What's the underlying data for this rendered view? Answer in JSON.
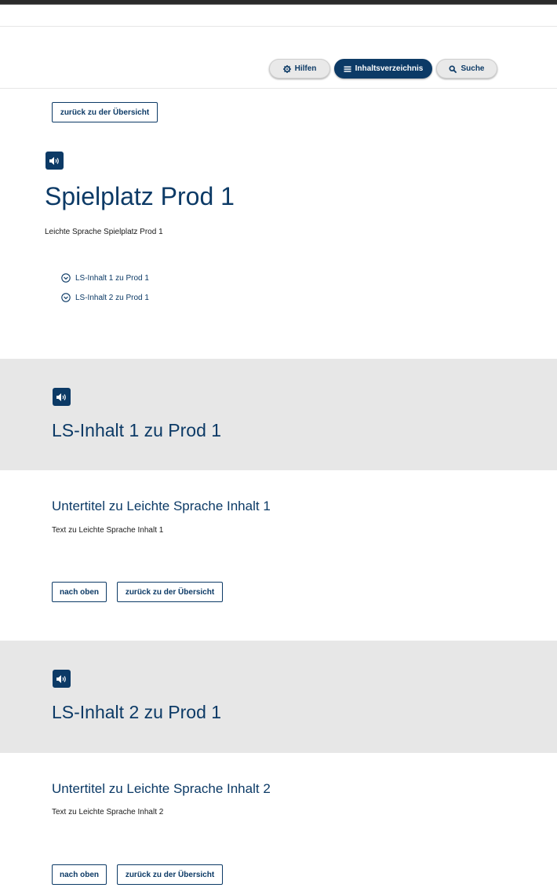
{
  "header": {
    "hilfen_label": "Hilfen",
    "inhaltsverzeichnis_label": "Inhaltsverzeichnis",
    "suche_label": "Suche"
  },
  "top": {
    "back_label": "zurück zu der Übersicht"
  },
  "page": {
    "title": "Spielplatz Prod 1",
    "intro": "Leichte Sprache Spielplatz Prod 1",
    "toc": [
      {
        "label": "LS-Inhalt 1 zu Prod 1"
      },
      {
        "label": "LS-Inhalt 2 zu Prod 1"
      }
    ]
  },
  "sections": [
    {
      "heading": "LS-Inhalt 1 zu Prod 1",
      "subtitle": "Untertitel zu Leichte Sprache Inhalt 1",
      "text": "Text zu Leichte Sprache Inhalt 1",
      "top_label": "nach oben",
      "back_label": "zurück zu der Übersicht"
    },
    {
      "heading": "LS-Inhalt 2 zu Prod 1",
      "subtitle": "Untertitel zu Leichte Sprache Inhalt 2",
      "text": "Text zu Leichte Sprache Inhalt 2",
      "top_label": "nach oben",
      "back_label": "zurück zu der Übersicht"
    }
  ],
  "icons": {
    "speaker": "speaker-icon",
    "gear": "gear-icon",
    "menu": "menu-icon",
    "search": "search-icon",
    "chevron": "chevron-down-circle-icon"
  },
  "colors": {
    "primary": "#0c3a66",
    "band": "#e7e7e7",
    "pill_light": "#e9e9e9"
  }
}
